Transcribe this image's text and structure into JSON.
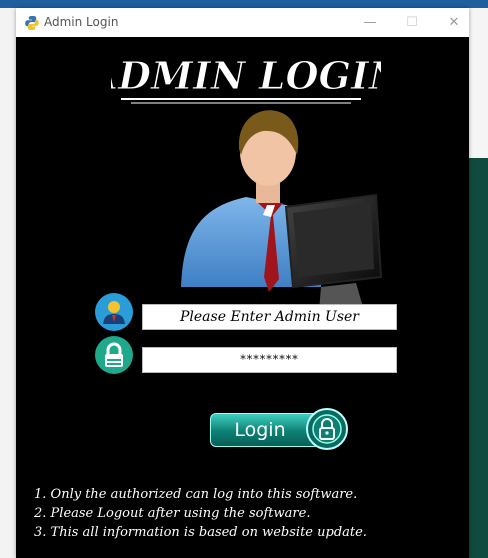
{
  "window": {
    "title": "Admin Login",
    "minimize_glyph": "—",
    "maximize_glyph": "☐",
    "close_glyph": "✕"
  },
  "header": {
    "heading": "ADMIN LOGIN"
  },
  "form": {
    "user_field": {
      "value": "Please Enter Admin User",
      "icon": "user-badge-icon"
    },
    "password_field": {
      "value": "*********",
      "icon": "lock-icon"
    },
    "login_button": {
      "label": "Login"
    }
  },
  "notes": [
    "1. Only the authorized can log into this software.",
    "2. Please Logout after using the software.",
    "3. This all information is based on website update."
  ],
  "colors": {
    "background": "#000000",
    "accent": "#0c8074",
    "window_border": "#1f5f9e"
  }
}
